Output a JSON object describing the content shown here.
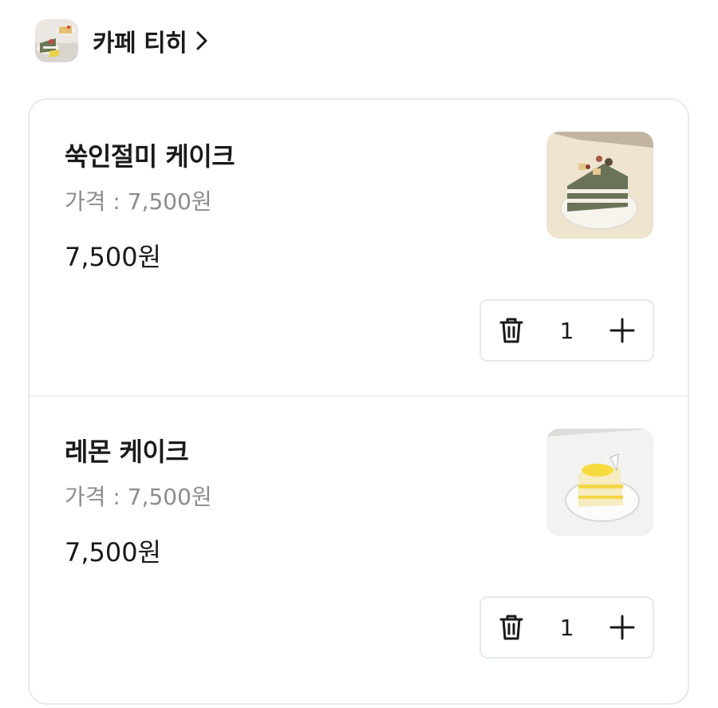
{
  "store": {
    "name": "카페 티히",
    "thumbnail_icon": "store-photo-cakes"
  },
  "cart": {
    "items": [
      {
        "name": "쑥인절미 케이크",
        "price_line": "가격 : 7,500원",
        "total": "7,500원",
        "quantity": "1",
        "image_icon": "mugwort-injeolmi-cake-photo"
      },
      {
        "name": "레몬 케이크",
        "price_line": "가격 : 7,500원",
        "total": "7,500원",
        "quantity": "1",
        "image_icon": "lemon-cake-photo"
      }
    ]
  },
  "colors": {
    "text": "#1a1a1a",
    "muted": "#8c8c8c",
    "border": "#e8eaee"
  }
}
